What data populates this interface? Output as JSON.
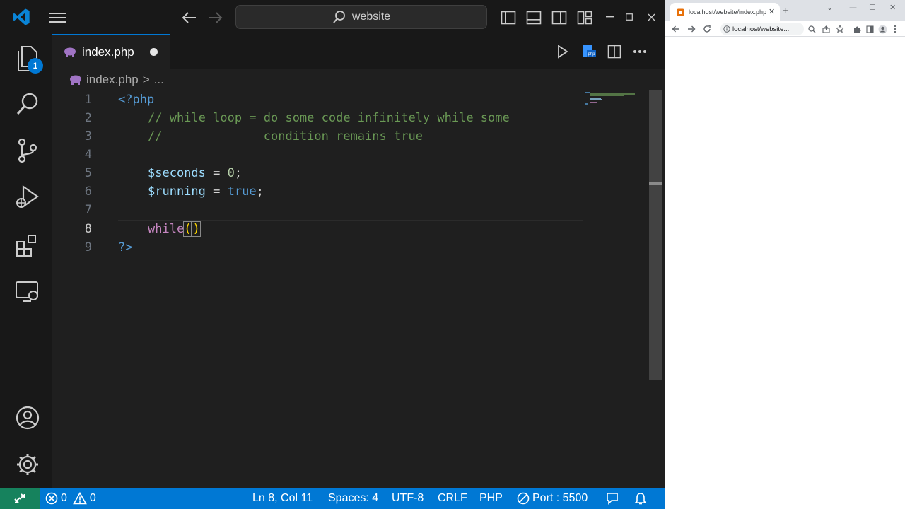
{
  "vscode": {
    "search_text": "website",
    "tab": {
      "label": "index.php"
    },
    "breadcrumb": {
      "file": "index.php",
      "sep": ">",
      "more": "..."
    },
    "explorer_badge": "1",
    "code_lines": [
      {
        "no": "1"
      },
      {
        "no": "2"
      },
      {
        "no": "3"
      },
      {
        "no": "4"
      },
      {
        "no": "5"
      },
      {
        "no": "6"
      },
      {
        "no": "7"
      },
      {
        "no": "8"
      },
      {
        "no": "9"
      }
    ],
    "code": {
      "l1_open": "<?php",
      "l2_comment": "// while loop = do some code infinitely while some",
      "l3_comment": "//              condition remains true",
      "l5_var": "$seconds",
      "l5_op": " = ",
      "l5_num": "0",
      "l5_end": ";",
      "l6_var": "$running",
      "l6_op": " = ",
      "l6_bool": "true",
      "l6_end": ";",
      "l8_kw": "while",
      "l8_open": "(",
      "l8_close": ")",
      "l9_close": "?>"
    },
    "statusbar": {
      "errors": "0",
      "warnings": "0",
      "position": "Ln 8, Col 11",
      "spaces": "Spaces: 4",
      "encoding": "UTF-8",
      "eol": "CRLF",
      "language": "PHP",
      "port": "Port : 5500"
    },
    "colors": {
      "accent": "#0078d4",
      "remote": "#16825d",
      "background": "#1f1f1f"
    }
  },
  "chrome": {
    "tab_title": "localhost/website/index.php",
    "url": "localhost/website..."
  }
}
